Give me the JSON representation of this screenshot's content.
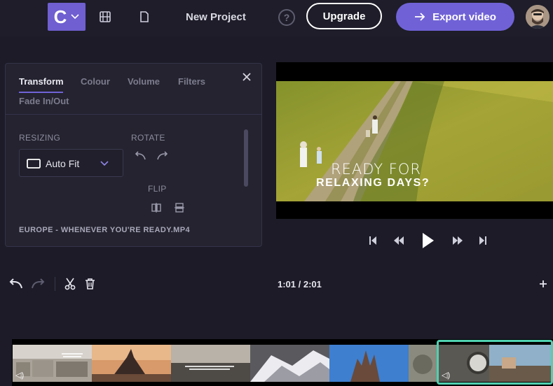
{
  "header": {
    "logo_letter": "C",
    "project_name": "New Project",
    "help_label": "?",
    "upgrade_label": "Upgrade",
    "export_label": "Export video",
    "accent_color": "#7062d6"
  },
  "panel": {
    "tabs": [
      "Transform",
      "Colour",
      "Volume",
      "Filters",
      "Fade In/Out"
    ],
    "active_tab": "Transform",
    "resizing_label": "RESIZING",
    "resize_value": "Auto Fit",
    "rotate_label": "ROTATE",
    "flip_label": "FLIP",
    "filename": "EUROPE - WHENEVER YOU'RE READY.MP4"
  },
  "preview": {
    "overlay_line1": "READY FOR",
    "overlay_line2": "RELAXING DAYS?"
  },
  "timeline": {
    "time_display": "1:01 / 2:01",
    "selected_clip_color": "#4fd1b0"
  },
  "icons": [
    "chevron-down-icon",
    "film-icon",
    "file-icon",
    "help-icon",
    "arrow-right-icon",
    "close-icon",
    "screen-icon",
    "rotate-left-icon",
    "rotate-right-icon",
    "flip-horizontal-icon",
    "flip-vertical-icon",
    "skip-back-icon",
    "rewind-icon",
    "play-icon",
    "fast-forward-icon",
    "skip-forward-icon",
    "undo-icon",
    "redo-icon",
    "scissors-icon",
    "trash-icon",
    "plus-icon",
    "volume-icon"
  ]
}
